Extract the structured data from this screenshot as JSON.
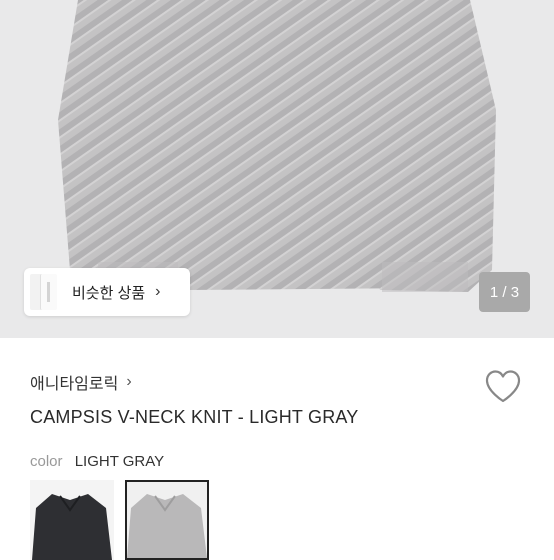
{
  "hero": {
    "similar_label": "비슷한 상품",
    "similar_chevron": "›",
    "pager": "1 / 3"
  },
  "product": {
    "brand": "애니타임로릭",
    "brand_chevron": "›",
    "title": "CAMPSIS V-NECK KNIT - LIGHT GRAY",
    "color_label": "color",
    "color_value": "LIGHT GRAY",
    "swatches": [
      {
        "name": "dark-navy",
        "color": "#2e2f33"
      },
      {
        "name": "light-gray",
        "color": "#b9b8b9"
      }
    ]
  },
  "colors": {
    "background": "#e9e9ea",
    "sweater": "#c2c1c2",
    "pager_bg": "#a9a9a9"
  },
  "icons": {
    "heart": "heart-icon",
    "chevron": "chevron-right-icon"
  }
}
